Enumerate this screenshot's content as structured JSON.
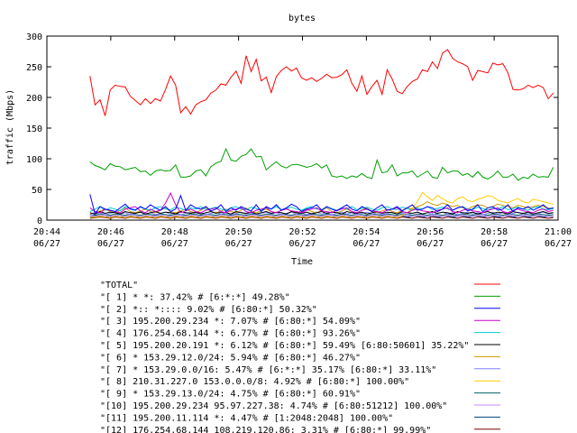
{
  "chart_data": {
    "type": "line",
    "title": "bytes",
    "xlabel": "Time",
    "ylabel": "traffic (Mbps)",
    "ylim": [
      0,
      300
    ],
    "xlim": [
      "20:44",
      "21:00"
    ],
    "x_unit": "minutes",
    "yticks": [
      "0",
      "50",
      "100",
      "150",
      "200",
      "250",
      "300"
    ],
    "xticks": [
      {
        "value": "20:44",
        "time": "20:44",
        "date": "06/27"
      },
      {
        "value": "20:46",
        "time": "20:46",
        "date": "06/27"
      },
      {
        "value": "20:48",
        "time": "20:48",
        "date": "06/27"
      },
      {
        "value": "20:50",
        "time": "20:50",
        "date": "06/27"
      },
      {
        "value": "20:52",
        "time": "20:52",
        "date": "06/27"
      },
      {
        "value": "20:54",
        "time": "20:54",
        "date": "06/27"
      },
      {
        "value": "20:56",
        "time": "20:56",
        "date": "06/27"
      },
      {
        "value": "20:58",
        "time": "20:58",
        "date": "06/27"
      },
      {
        "value": "21:00",
        "time": "21:00",
        "date": "06/27"
      }
    ],
    "grid": false,
    "legend_position": "bottom",
    "series": [
      {
        "name": "\"TOTAL\"",
        "color": "#ff0000",
        "values": [
          235,
          188,
          196,
          170,
          212,
          220,
          218,
          217,
          202,
          195,
          188,
          198,
          190,
          198,
          194,
          213,
          235,
          220,
          175,
          185,
          173,
          188,
          193,
          196,
          207,
          212,
          222,
          220,
          233,
          243,
          223,
          268,
          242,
          262,
          227,
          233,
          208,
          234,
          244,
          250,
          243,
          248,
          232,
          228,
          232,
          226,
          231,
          238,
          232,
          233,
          237,
          245,
          223,
          210,
          235,
          205,
          218,
          228,
          205,
          245,
          230,
          210,
          206,
          218,
          226,
          230,
          245,
          242,
          258,
          247,
          272,
          278,
          264,
          258,
          255,
          250,
          228,
          244,
          242,
          240,
          256,
          253,
          255,
          240,
          213,
          212,
          214,
          220,
          216,
          220,
          216,
          198,
          207
        ]
      },
      {
        "name": "\"[ 1] * *: 37.42% # [6:*:*] 49.28%\"",
        "color": "#00a000",
        "values": [
          95,
          89,
          86,
          82,
          92,
          88,
          87,
          82,
          84,
          86,
          79,
          80,
          73,
          80,
          82,
          80,
          81,
          90,
          70,
          70,
          72,
          80,
          82,
          72,
          87,
          93,
          96,
          116,
          98,
          96,
          104,
          107,
          116,
          103,
          104,
          82,
          89,
          95,
          88,
          85,
          90,
          91,
          89,
          86,
          88,
          92,
          85,
          90,
          72,
          70,
          72,
          68,
          72,
          70,
          76,
          70,
          68,
          98,
          77,
          79,
          90,
          72,
          77,
          77,
          80,
          70,
          75,
          80,
          70,
          68,
          86,
          77,
          80,
          80,
          73,
          76,
          70,
          79,
          70,
          67,
          72,
          80,
          70,
          70,
          75,
          65,
          70,
          68,
          75,
          70,
          71,
          70,
          86
        ]
      },
      {
        "name": "\"[ 2] *:: *:::: 9.02% # [6:80:*] 50.32%\"",
        "color": "#0000ff",
        "values": [
          42,
          10,
          22,
          18,
          16,
          14,
          20,
          26,
          18,
          16,
          22,
          18,
          25,
          20,
          16,
          22,
          14,
          18,
          40,
          16,
          25,
          20,
          18,
          22,
          15,
          18,
          25,
          14,
          20,
          16,
          22,
          18,
          15,
          25,
          14,
          22,
          18,
          25,
          16,
          20,
          26,
          22,
          14,
          18,
          20,
          25,
          16,
          22,
          18,
          15,
          20,
          25,
          18,
          15,
          22,
          18,
          14,
          20,
          25,
          16,
          18,
          22,
          15,
          20,
          25,
          16,
          18,
          22,
          20,
          14,
          18,
          25,
          16,
          20,
          22,
          15,
          18,
          25,
          14,
          20,
          22,
          16,
          18,
          25,
          14,
          20,
          18,
          22,
          16,
          20,
          25,
          18,
          20
        ]
      },
      {
        "name": "\"[ 3] 195.200.29.234 *: 7.07% # [6:80:*] 54.09%\"",
        "color": "#cc00cc",
        "values": [
          20,
          14,
          12,
          18,
          16,
          14,
          12,
          18,
          20,
          22,
          15,
          12,
          18,
          14,
          16,
          28,
          44,
          25,
          12,
          15,
          18,
          14,
          12,
          16,
          18,
          20,
          14,
          12,
          16,
          18,
          20,
          14,
          12,
          16,
          18,
          20,
          14,
          12,
          16,
          18,
          15,
          14,
          12,
          16,
          18,
          20,
          15,
          14,
          12,
          16,
          18,
          20,
          14,
          12,
          16,
          18,
          15,
          14,
          12,
          16,
          18,
          20,
          14,
          12,
          16,
          18,
          15,
          14,
          12,
          16,
          18,
          20,
          14,
          12,
          16,
          18,
          15,
          14,
          12,
          16,
          18,
          20,
          14,
          12,
          16,
          18,
          15,
          14,
          12,
          16,
          18,
          14,
          16
        ]
      },
      {
        "name": "\"[ 4] 176.254.68.144 *: 6.77% # [6:80:*] 93.26%\"",
        "color": "#00cccc",
        "values": [
          14,
          18,
          22,
          16,
          20,
          18,
          15,
          22,
          19,
          17,
          21,
          18,
          16,
          20,
          22,
          18,
          17,
          21,
          19,
          16,
          20,
          18,
          22,
          17,
          19,
          21,
          18,
          16,
          20,
          22,
          18,
          17,
          21,
          19,
          16,
          20,
          18,
          22,
          17,
          19,
          21,
          18,
          16,
          20,
          22,
          18,
          17,
          21,
          19,
          16,
          20,
          18,
          22,
          17,
          19,
          21,
          18,
          16,
          20,
          22,
          18,
          17,
          21,
          19,
          16,
          20,
          18,
          22,
          17,
          19,
          21,
          18,
          16,
          20,
          22,
          18,
          17,
          21,
          19,
          16,
          20,
          18,
          22,
          17,
          19,
          21,
          18,
          16,
          20,
          22,
          18,
          17,
          19
        ]
      },
      {
        "name": "\"[ 5] 195.200.20.191 *: 6.12% # [6:80:*] 59.49% [6:80:50601] 35.22%\"",
        "color": "#000000",
        "values": [
          12,
          10,
          14,
          11,
          13,
          12,
          10,
          14,
          12,
          11,
          13,
          10,
          12,
          14,
          11,
          13,
          12,
          10,
          14,
          12,
          11,
          13,
          10,
          12,
          14,
          11,
          13,
          12,
          10,
          14,
          12,
          11,
          13,
          10,
          12,
          14,
          11,
          13,
          12,
          10,
          14,
          12,
          11,
          13,
          10,
          12,
          14,
          11,
          13,
          12,
          10,
          14,
          12,
          11,
          13,
          10,
          12,
          14,
          11,
          13,
          12,
          10,
          14,
          12,
          11,
          13,
          10,
          12,
          14,
          11,
          13,
          12,
          10,
          14,
          12,
          11,
          13,
          10,
          12,
          14,
          11,
          13,
          12,
          10,
          14,
          12,
          11,
          13,
          10,
          12,
          14,
          11,
          12
        ]
      },
      {
        "name": "\"[ 6] * 153.29.12.0/24: 5.94% # [6:80:*] 46.27%\"",
        "color": "#cc9900",
        "values": [
          10,
          12,
          15,
          18,
          14,
          12,
          16,
          20,
          14,
          12,
          15,
          18,
          14,
          12,
          16,
          20,
          14,
          12,
          15,
          18,
          14,
          12,
          16,
          20,
          14,
          12,
          15,
          18,
          14,
          12,
          16,
          20,
          14,
          12,
          15,
          18,
          14,
          12,
          16,
          20,
          14,
          12,
          15,
          18,
          14,
          12,
          16,
          20,
          14,
          12,
          15,
          18,
          14,
          12,
          16,
          20,
          14,
          12,
          15,
          18,
          14,
          12,
          16,
          20,
          18,
          22,
          25,
          30,
          26,
          24,
          28,
          25,
          22,
          24,
          20,
          18,
          22,
          25,
          24,
          20,
          22,
          26,
          24,
          22,
          20,
          24,
          22,
          20,
          22,
          24,
          22,
          20,
          18
        ]
      },
      {
        "name": "\"[ 7] * 153.29.0.0/16: 5.47% # [6:*:*] 35.17% [6:80:*] 33.11%\"",
        "color": "#8080ff",
        "values": [
          8,
          10,
          12,
          9,
          11,
          13,
          10,
          12,
          9,
          11,
          13,
          10,
          12,
          9,
          11,
          13,
          10,
          12,
          9,
          11,
          13,
          10,
          12,
          9,
          11,
          13,
          10,
          12,
          9,
          11,
          13,
          10,
          12,
          9,
          11,
          13,
          10,
          12,
          9,
          11,
          13,
          10,
          12,
          9,
          11,
          13,
          10,
          12,
          9,
          11,
          13,
          10,
          12,
          9,
          11,
          13,
          10,
          12,
          9,
          11,
          13,
          10,
          12,
          9,
          11,
          13,
          10,
          12,
          9,
          11,
          13,
          10,
          12,
          9,
          11,
          13,
          10,
          12,
          9,
          11,
          13,
          10,
          12,
          9,
          11,
          13,
          10,
          12,
          9,
          11,
          13,
          10,
          12
        ]
      },
      {
        "name": "\"[ 8] 210.31.227.0 153.0.0.0/8: 4.92% # [6:80:*] 100.00%\"",
        "color": "#ffcc00",
        "values": [
          4,
          5,
          6,
          5,
          4,
          6,
          5,
          4,
          6,
          5,
          4,
          6,
          5,
          4,
          6,
          5,
          4,
          6,
          5,
          4,
          6,
          5,
          4,
          6,
          5,
          4,
          6,
          5,
          4,
          6,
          5,
          4,
          6,
          5,
          4,
          6,
          5,
          4,
          6,
          5,
          4,
          6,
          5,
          4,
          6,
          5,
          4,
          6,
          5,
          4,
          6,
          5,
          4,
          6,
          5,
          4,
          6,
          5,
          4,
          6,
          5,
          4,
          8,
          12,
          20,
          30,
          45,
          38,
          32,
          40,
          35,
          30,
          28,
          35,
          38,
          32,
          30,
          34,
          36,
          40,
          38,
          32,
          30,
          28,
          32,
          35,
          30,
          28,
          34,
          32,
          30,
          28,
          26
        ]
      },
      {
        "name": "\"[ 9] * 153.29.13.0/24: 4.75% # [6:80:*] 60.91%\"",
        "color": "#006060",
        "values": [
          9,
          8,
          10,
          9,
          8,
          10,
          9,
          8,
          10,
          9,
          8,
          10,
          9,
          8,
          10,
          9,
          8,
          10,
          9,
          8,
          10,
          9,
          8,
          10,
          9,
          8,
          10,
          9,
          8,
          10,
          9,
          8,
          10,
          9,
          8,
          10,
          9,
          8,
          10,
          9,
          8,
          10,
          9,
          8,
          10,
          9,
          8,
          10,
          9,
          8,
          10,
          9,
          8,
          10,
          9,
          8,
          10,
          9,
          8,
          10,
          9,
          8,
          10,
          9,
          8,
          10,
          9,
          8,
          10,
          9,
          8,
          10,
          9,
          8,
          10,
          9,
          8,
          10,
          9,
          8,
          10,
          9,
          8,
          10,
          9,
          8,
          10,
          9,
          8,
          10,
          9,
          8,
          9
        ]
      },
      {
        "name": "\"[10] 195.200.29.234 95.97.227.38: 4.74% # [6:80:51212] 100.00%\"",
        "color": "#cc88ff",
        "values": [
          6,
          7,
          8,
          7,
          6,
          8,
          7,
          6,
          8,
          7,
          6,
          8,
          7,
          6,
          8,
          7,
          6,
          8,
          7,
          6,
          8,
          7,
          6,
          8,
          7,
          6,
          8,
          7,
          6,
          8,
          7,
          6,
          8,
          7,
          6,
          8,
          7,
          6,
          8,
          7,
          6,
          8,
          7,
          6,
          8,
          7,
          6,
          8,
          7,
          6,
          8,
          7,
          6,
          8,
          7,
          6,
          8,
          7,
          6,
          8,
          7,
          6,
          8,
          7,
          6,
          8,
          7,
          6,
          8,
          7,
          6,
          8,
          7,
          6,
          8,
          7,
          6,
          8,
          7,
          6,
          8,
          7,
          6,
          8,
          7,
          6,
          8,
          7,
          6,
          8,
          7,
          6,
          7
        ]
      },
      {
        "name": "\"[11] 195.200.11.114 *: 4.47% # [1:2048:2048] 100.00%\"",
        "color": "#004080",
        "values": [
          5,
          6,
          7,
          5,
          6,
          7,
          5,
          6,
          7,
          5,
          6,
          7,
          5,
          6,
          7,
          5,
          6,
          7,
          5,
          6,
          7,
          5,
          6,
          7,
          5,
          6,
          7,
          5,
          6,
          7,
          5,
          6,
          7,
          5,
          6,
          7,
          5,
          6,
          7,
          5,
          6,
          7,
          5,
          6,
          7,
          5,
          6,
          7,
          5,
          6,
          7,
          5,
          6,
          7,
          5,
          6,
          7,
          5,
          6,
          7,
          5,
          6,
          7,
          5,
          6,
          7,
          5,
          6,
          7,
          5,
          6,
          7,
          5,
          6,
          7,
          5,
          6,
          7,
          5,
          6,
          7,
          5,
          6,
          7,
          5,
          6,
          7,
          5,
          6,
          7,
          5,
          6,
          6
        ]
      },
      {
        "name": "\"[12] 176.254.68.144 108.219.120.86: 3.31% # [6:80:*] 99.99%\"",
        "color": "#800000",
        "values": [
          3,
          4,
          5,
          4,
          3,
          5,
          4,
          3,
          5,
          4,
          3,
          5,
          4,
          3,
          5,
          4,
          3,
          5,
          4,
          3,
          5,
          4,
          3,
          5,
          4,
          3,
          5,
          4,
          3,
          5,
          4,
          3,
          5,
          4,
          3,
          5,
          4,
          3,
          5,
          4,
          3,
          5,
          4,
          3,
          5,
          4,
          3,
          5,
          4,
          3,
          5,
          4,
          3,
          5,
          4,
          3,
          5,
          4,
          3,
          5,
          4,
          3,
          5,
          4,
          3,
          5,
          4,
          3,
          5,
          4,
          3,
          5,
          4,
          3,
          5,
          4,
          3,
          5,
          4,
          3,
          5,
          4,
          3,
          5,
          4,
          3,
          5,
          4,
          3,
          5,
          4,
          3,
          4
        ]
      }
    ]
  }
}
